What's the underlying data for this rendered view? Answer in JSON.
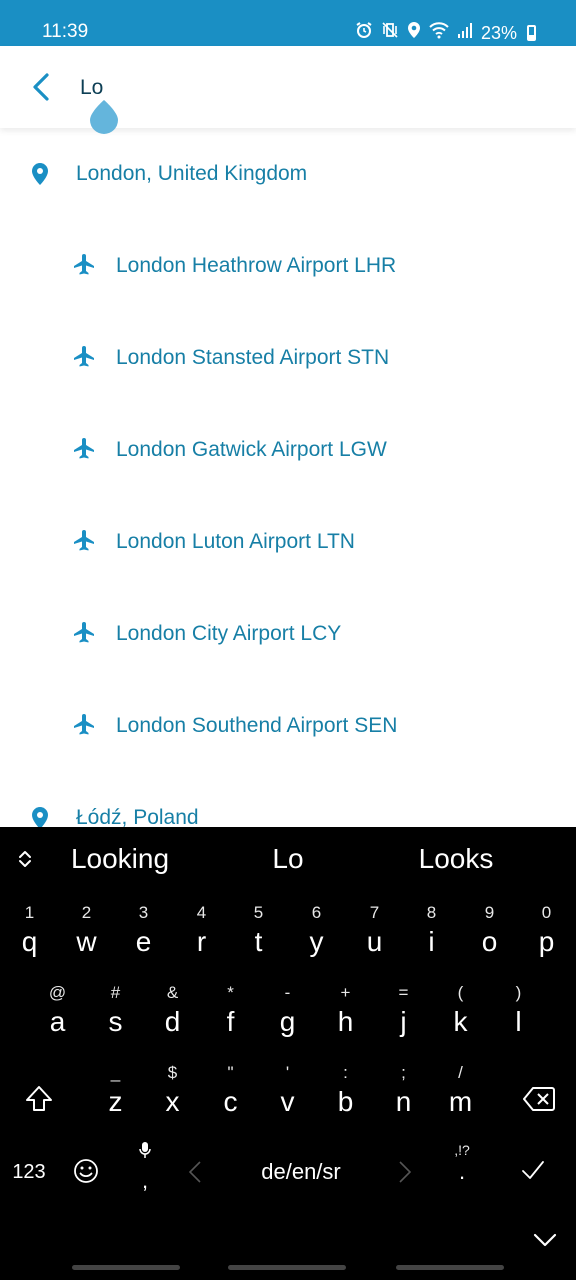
{
  "status_bar": {
    "time": "11:39",
    "battery": "23%",
    "icons": [
      "alarm-icon",
      "mute-vibrate-icon",
      "location-icon",
      "wifi-icon",
      "signal-icon",
      "battery-icon"
    ]
  },
  "search": {
    "value": "Lo",
    "back_icon": "chevron-left-icon"
  },
  "results": [
    {
      "type": "city",
      "label": "London, United Kingdom",
      "icon": "location-pin-icon"
    },
    {
      "type": "airport",
      "label": "London Heathrow Airport LHR",
      "icon": "airplane-icon"
    },
    {
      "type": "airport",
      "label": "London Stansted Airport STN",
      "icon": "airplane-icon"
    },
    {
      "type": "airport",
      "label": "London Gatwick Airport LGW",
      "icon": "airplane-icon"
    },
    {
      "type": "airport",
      "label": "London Luton Airport LTN",
      "icon": "airplane-icon"
    },
    {
      "type": "airport",
      "label": "London City Airport LCY",
      "icon": "airplane-icon"
    },
    {
      "type": "airport",
      "label": "London Southend Airport SEN",
      "icon": "airplane-icon"
    },
    {
      "type": "city",
      "label": "Łódź, Poland",
      "icon": "location-pin-icon"
    }
  ],
  "keyboard": {
    "suggestions": [
      "Looking",
      "Lo",
      "Looks"
    ],
    "row1": [
      {
        "hint": "1",
        "key": "q"
      },
      {
        "hint": "2",
        "key": "w"
      },
      {
        "hint": "3",
        "key": "e"
      },
      {
        "hint": "4",
        "key": "r"
      },
      {
        "hint": "5",
        "key": "t"
      },
      {
        "hint": "6",
        "key": "y"
      },
      {
        "hint": "7",
        "key": "u"
      },
      {
        "hint": "8",
        "key": "i"
      },
      {
        "hint": "9",
        "key": "o"
      },
      {
        "hint": "0",
        "key": "p"
      }
    ],
    "row2": [
      {
        "hint": "@",
        "key": "a"
      },
      {
        "hint": "#",
        "key": "s"
      },
      {
        "hint": "&",
        "key": "d"
      },
      {
        "hint": "*",
        "key": "f"
      },
      {
        "hint": "-",
        "key": "g"
      },
      {
        "hint": "+",
        "key": "h"
      },
      {
        "hint": "=",
        "key": "j"
      },
      {
        "hint": "(",
        "key": "k"
      },
      {
        "hint": ")",
        "key": "l"
      }
    ],
    "row3": [
      {
        "hint": "_",
        "key": "z"
      },
      {
        "hint": "$",
        "key": "x"
      },
      {
        "hint": "\"",
        "key": "c"
      },
      {
        "hint": "'",
        "key": "v"
      },
      {
        "hint": ":",
        "key": "b"
      },
      {
        "hint": ";",
        "key": "n"
      },
      {
        "hint": "/",
        "key": "m"
      }
    ],
    "numbers_label": "123",
    "space_label": "de/en/sr",
    "comma": ",",
    "period": ".",
    "punct_hint": ",!?"
  },
  "colors": {
    "accent": "#1a8fc4",
    "result_text": "#177fa6",
    "keyboard_bg": "#000000"
  }
}
